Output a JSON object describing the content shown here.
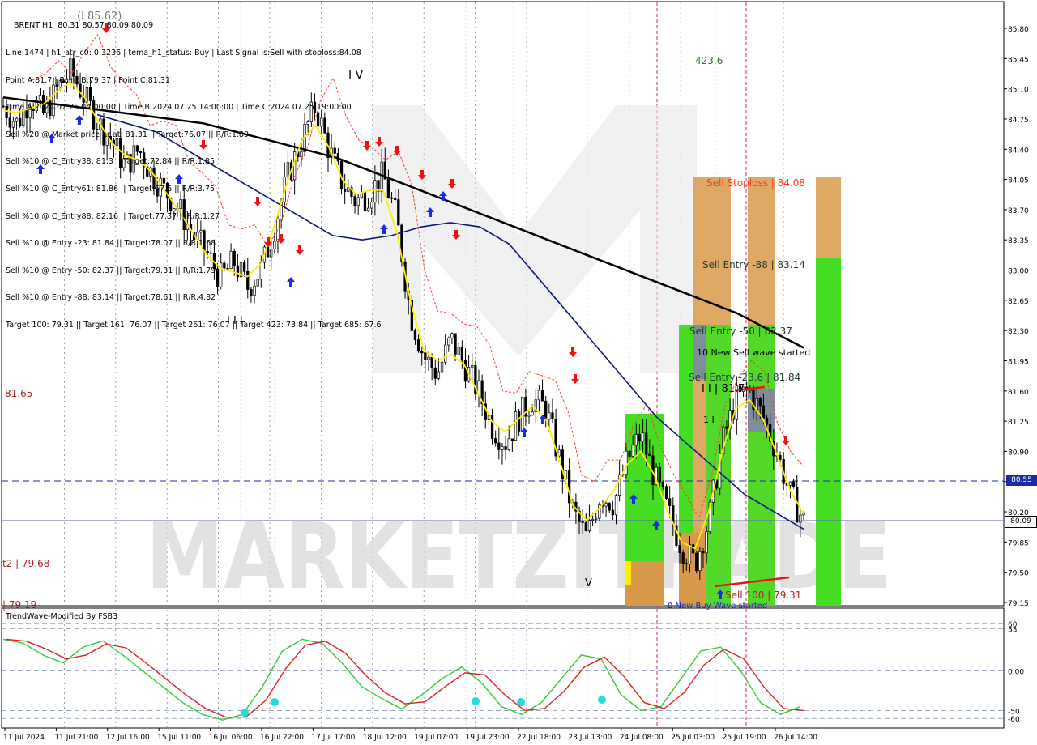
{
  "window": {
    "symbol_line": "BRENT,H1  80.31 80.57 80.09 80.09"
  },
  "info_lines": [
    "Line:1474 | h1_atr_c0: 0.3236 | tema_h1_status: Buy | Last Signal is:Sell with stoploss:84.08",
    "Point A:81.7 | Point B:79.37 | Point C:81.31",
    "Time A:2024.07.26 04:00:00 | Time B:2024.07.25 14:00:00 | Time C:2024.07.25 19:00:00",
    "Sell %20 @ Market price or at: 81.31 || Target:76.07 || R/R:1.89",
    "Sell %10 @ C_Entry38: 81.3 || Target:72.84 || R/R:1.85",
    "Sell %10 @ C_Entry61: 81.86 || Target:67.6 || R/R:3.75",
    "Sell %10 @ C_Entry88: 82.16 || Target:77.37 || R/R:1.27",
    "Sell %10 @ Entry -23: 81.84 || Target:78.07 || R/R:1.68",
    "Sell %10 @ Entry -50: 82.37 || Target:79.31 || R/R:1.79",
    "Sell %10 @ Entry -88: 83.14 || Target:78.61 || R/R:4.82",
    "Target 100: 79.31 || Target 161: 76.07 || Target 261: 76.07 || Target 423: 73.84 || Target 685: 67.6"
  ],
  "chart_annotations": {
    "wave_iv": "I V",
    "wave_iii": "I I I",
    "wave_v": "V",
    "wave_top": "423.6",
    "left_level_1": "81.65",
    "left_level_2": "t2 | 79.68",
    "left_level_3": "| 79.19",
    "top_label": "(I 85.62)",
    "sell_stoploss": "Sell Stoploss | 84.08",
    "sell_entry_88": "Sell Entry -88 | 83.14",
    "sell_entry_50": "Sell Entry -50 | 82.37",
    "new_sell_wave": "10 New Sell wave started",
    "sell_entry_23": "Sell Entry -23.6 | 81.84",
    "wave_ii": "I I | 81.7",
    "sell_100": "Sell 100 | 79.31",
    "new_buy_wave": "0 New Buy Wave started",
    "wave_i": "1 I",
    "watermark": "MARKETZITRADE"
  },
  "price_axis": {
    "labels": [
      "85.80",
      "85.45",
      "85.10",
      "84.75",
      "84.40",
      "84.05",
      "83.70",
      "83.35",
      "83.00",
      "82.65",
      "82.30",
      "81.95",
      "81.60",
      "81.25",
      "80.90",
      "80.55",
      "80.20",
      "79.85",
      "79.50",
      "79.15"
    ],
    "current_price": "80.09",
    "dashed_level": "80.55"
  },
  "time_axis": {
    "labels": [
      "11 Jul 2024",
      "11 Jul 21:00",
      "12 Jul 16:00",
      "15 Jul 11:00",
      "16 Jul 06:00",
      "16 Jul 22:00",
      "17 Jul 17:00",
      "18 Jul 12:00",
      "19 Jul 07:00",
      "19 Jul 23:00",
      "22 Jul 18:00",
      "23 Jul 13:00",
      "24 Jul 08:00",
      "25 Jul 03:00",
      "25 Jul 19:00",
      "26 Jul 14:00"
    ]
  },
  "indicator": {
    "title": "TrendWave-Modified By FSB3",
    "axis_labels": [
      "60",
      "53",
      "0.00",
      "-50",
      "-60"
    ]
  },
  "colors": {
    "candle": "#000000",
    "ma_black": "#000000",
    "ma_navy": "#0a1a7a",
    "tema_yellow": "#ffee00",
    "envelope_red": "#ff3b2f",
    "green_zone": "#44dd22",
    "orange_zone": "#d89a4a",
    "gray_zone": "#7f8c99",
    "osc_green": "#33cc33",
    "osc_red": "#dd2222",
    "osc_dot": "#22dddd"
  },
  "chart_data": {
    "type": "candlestick",
    "symbol": "BRENT",
    "timeframe": "H1",
    "ylim": [
      79.1,
      86.0
    ],
    "close_series": [
      84.9,
      84.7,
      85.0,
      84.8,
      85.1,
      85.3,
      85.0,
      84.7,
      84.5,
      84.2,
      84.4,
      84.1,
      83.9,
      83.7,
      83.4,
      83.2,
      82.9,
      83.1,
      82.8,
      83.0,
      83.5,
      84.1,
      84.5,
      84.9,
      84.4,
      84.0,
      83.8,
      83.9,
      84.1,
      83.6,
      82.5,
      82.0,
      81.8,
      82.2,
      81.9,
      81.6,
      81.2,
      81.0,
      81.3,
      81.5,
      81.4,
      80.8,
      80.2,
      79.9,
      80.4,
      80.3,
      80.8,
      81.1,
      80.6,
      80.2,
      79.8,
      79.6,
      80.1,
      81.0,
      81.5,
      81.6,
      81.3,
      80.9,
      80.4,
      80.1
    ],
    "ma_long": [
      85.0,
      84.95,
      84.9,
      84.85,
      84.8,
      84.75,
      84.7,
      84.6,
      84.5,
      84.4,
      84.3,
      84.15,
      84.0,
      83.85,
      83.7,
      83.55,
      83.4,
      83.25,
      83.1,
      82.95,
      82.8,
      82.65,
      82.5,
      82.3,
      82.1
    ],
    "ma_mid": [
      84.8,
      84.7,
      84.6,
      84.4,
      84.2,
      84.0,
      83.8,
      83.6,
      83.4,
      83.35,
      83.4,
      83.5,
      83.55,
      83.5,
      83.3,
      82.9,
      82.5,
      82.1,
      81.7,
      81.3,
      81.0,
      80.7,
      80.4,
      80.2,
      80.0
    ],
    "oscillator": {
      "ylim": [
        -70,
        70
      ],
      "levels": [
        60,
        53,
        0,
        -50,
        -60
      ],
      "values": [
        40,
        35,
        20,
        10,
        30,
        38,
        20,
        0,
        -20,
        -40,
        -55,
        -62,
        -55,
        -20,
        25,
        40,
        35,
        10,
        -20,
        -35,
        -48,
        -30,
        -10,
        5,
        -15,
        -45,
        -55,
        -40,
        -10,
        20,
        15,
        -30,
        -50,
        -45,
        -10,
        25,
        30,
        0,
        -40,
        -55,
        -45
      ]
    }
  }
}
